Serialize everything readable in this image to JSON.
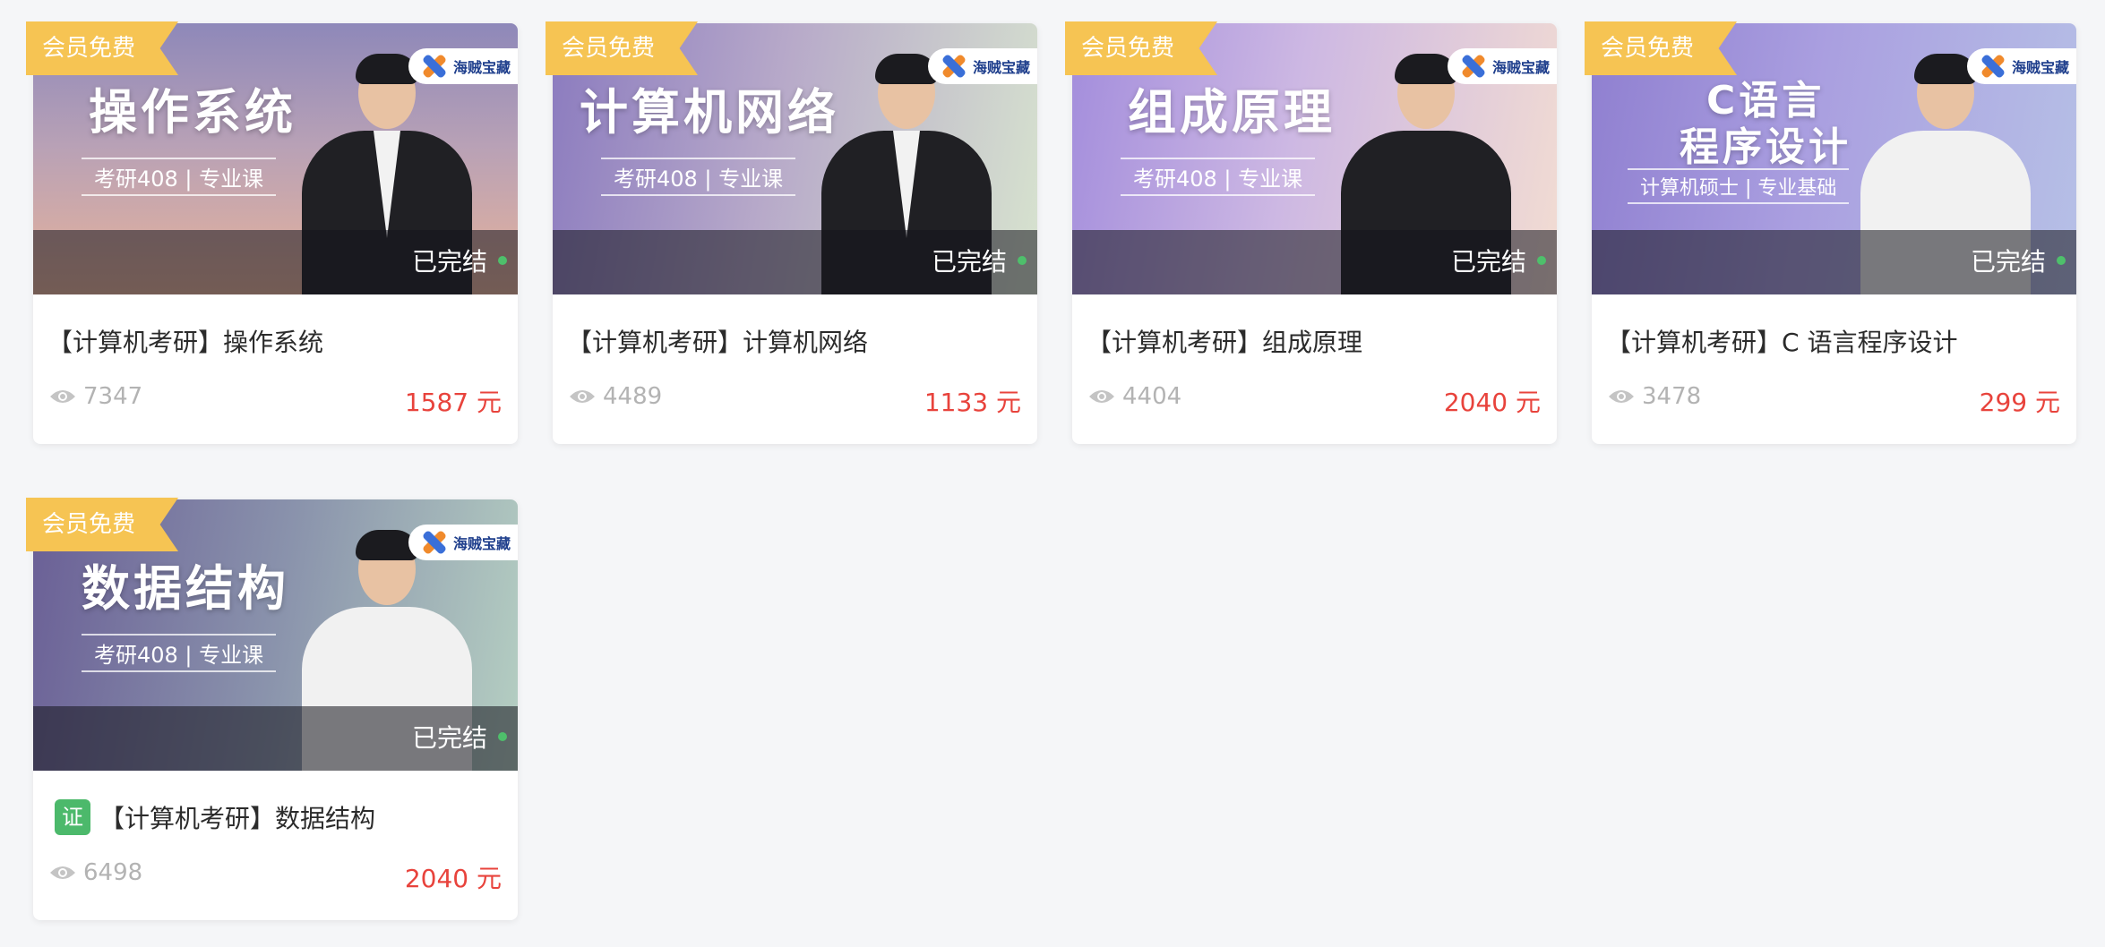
{
  "courses": [
    {
      "ribbon": "会员免费",
      "logo": "海贼宝藏",
      "banner_title": "操作系统",
      "banner_subtitle": "考研408 | 专业课",
      "status": "已完结",
      "title": "【计算机考研】操作系统",
      "views": "7347",
      "price": "1587 元",
      "certified": false
    },
    {
      "ribbon": "会员免费",
      "logo": "海贼宝藏",
      "banner_title": "计算机网络",
      "banner_subtitle": "考研408 | 专业课",
      "status": "已完结",
      "title": "【计算机考研】计算机网络",
      "views": "4489",
      "price": "1133 元",
      "certified": false
    },
    {
      "ribbon": "会员免费",
      "logo": "海贼宝藏",
      "banner_title": "组成原理",
      "banner_subtitle": "考研408 | 专业课",
      "status": "已完结",
      "title": "【计算机考研】组成原理",
      "views": "4404",
      "price": "2040 元",
      "certified": false
    },
    {
      "ribbon": "会员免费",
      "logo": "海贼宝藏",
      "banner_title_line1": "C语言",
      "banner_title_line2": "程序设计",
      "banner_subtitle": "计算机硕士 | 专业基础",
      "status": "已完结",
      "title": "【计算机考研】C 语言程序设计",
      "views": "3478",
      "price": "299 元",
      "certified": false
    },
    {
      "ribbon": "会员免费",
      "logo": "海贼宝藏",
      "banner_title": "数据结构",
      "banner_subtitle": "考研408 | 专业课",
      "status": "已完结",
      "title": "【计算机考研】数据结构",
      "views": "6498",
      "price": "2040 元",
      "certified": true,
      "cert_label": "证"
    }
  ],
  "colors": {
    "ribbon": "#f6c453",
    "price": "#e8433c",
    "status_dot": "#4ebf6b",
    "cert_badge": "#4cb96b",
    "page_bg": "#f5f6f8"
  },
  "icons": {
    "views": "eye-icon",
    "status": "status-dot",
    "logo": "x-logo-mark"
  }
}
